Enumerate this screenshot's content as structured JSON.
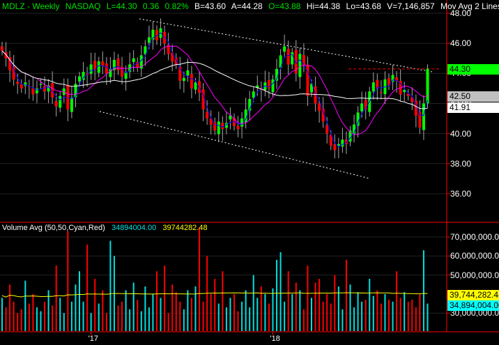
{
  "header": {
    "symbol": "MDLZ - Weekly",
    "exchange": "NASDAQ",
    "last": "L=44.30",
    "change": "0.36",
    "pct": "0.82%",
    "bid": "B=43.60",
    "ask": "A=44.28",
    "open": "O=43.88",
    "high": "Hi=44.38",
    "low": "Lo=43.68",
    "volume": "V=7,146,857",
    "study": "Mov Avg 2 Lines ..."
  },
  "volume_header": {
    "title": "Volume Avg (50,50,Cyan,Red)",
    "vol": "34894004.00",
    "avg": "39744282.48"
  },
  "colors": {
    "up": "#00ff00",
    "down": "#ff0000",
    "ma_fast": "#ff00ff",
    "ma_slow": "#ffffff",
    "ma_short": "#0000ff",
    "vol_up": "#00e0e0",
    "vol_down": "#ff0000",
    "vol_avg": "#ffff00",
    "axis": "#ff0000"
  },
  "chart_data": [
    {
      "type": "candlestick",
      "title": "MDLZ - Weekly",
      "ylim": [
        34.5,
        49
      ],
      "y_ticks": [
        "48.00",
        "46.00",
        "44.00",
        "42.00",
        "40.00",
        "38.00",
        "36.00"
      ],
      "y_tick_values": [
        48,
        46,
        44,
        42,
        40,
        38,
        36
      ],
      "x_ticks": [
        "'17",
        "'18"
      ],
      "x_tick_index": [
        23,
        70
      ],
      "price_labels": [
        {
          "text": "44.30",
          "value": 44.3,
          "bg": "#00ff00"
        },
        {
          "text": "42.50",
          "value": 42.5,
          "bg": "#c0c0c0"
        },
        {
          "text": "41.91",
          "value": 41.91,
          "bg": "#ffffff"
        }
      ],
      "resistance": 44.3,
      "closes": [
        45.5,
        45,
        44.2,
        43.6,
        43.3,
        43.0,
        43.4,
        43.1,
        42.6,
        43.0,
        43.3,
        42.8,
        43.2,
        42.4,
        41.8,
        42.5,
        43.0,
        41.6,
        42.4,
        43.3,
        43.8,
        44.1,
        43.9,
        44.6,
        44.2,
        44.8,
        44.5,
        44.0,
        44.3,
        44.9,
        44.2,
        43.8,
        44.1,
        44.6,
        45.0,
        44.4,
        45.2,
        45.8,
        46.4,
        46.9,
        46.2,
        47.0,
        46.0,
        45.3,
        44.8,
        44.6,
        43.5,
        43.7,
        44.2,
        43.0,
        43.4,
        42.7,
        41.6,
        41.0,
        40.6,
        40.2,
        40.8,
        40.3,
        40.7,
        41.2,
        40.5,
        40.3,
        41.0,
        41.6,
        42.3,
        42.8,
        43.2,
        42.9,
        43.4,
        43.0,
        43.6,
        44.3,
        45.2,
        45.8,
        44.6,
        45.4,
        44.0,
        45.3,
        44.5,
        42.5,
        43.3,
        42.0,
        41.5,
        40.8,
        40.0,
        39.2,
        38.9,
        39.3,
        39.6,
        39.3,
        40.2,
        40.6,
        41.4,
        42.0,
        41.6,
        42.8,
        43.4,
        43.0,
        42.7,
        43.6,
        43.2,
        43.9,
        43.5,
        42.6,
        42.9,
        42.5,
        42.1,
        41.2,
        40.4,
        42.0,
        44.3
      ]
    },
    {
      "type": "bar",
      "title": "Volume Avg (50,50,Cyan,Red)",
      "ylim": [
        20,
        75
      ],
      "unit": "millions",
      "y_ticks": [
        "70,000,000.00",
        "60,000,000.00",
        "50,000,000.00",
        "30,000,000.00"
      ],
      "y_tick_values": [
        70,
        60,
        50,
        30
      ],
      "value_labels": [
        {
          "text": "39,744,282.48",
          "value": 39.74,
          "bg": "#ffff00"
        },
        {
          "text": "34,894,004.00",
          "value": 34.89,
          "bg": "#00ffff"
        }
      ],
      "volumes": [
        38,
        33,
        45,
        36,
        30,
        32,
        47,
        35,
        40,
        33,
        31,
        36,
        42,
        34,
        55,
        38,
        30,
        73,
        36,
        45,
        52,
        36,
        66,
        30,
        48,
        35,
        42,
        30,
        68,
        60,
        34,
        36,
        42,
        32,
        46,
        37,
        31,
        44,
        33,
        40,
        52,
        38,
        55,
        30,
        45,
        41,
        36,
        32,
        42,
        38,
        44,
        75,
        36,
        60,
        40,
        48,
        35,
        52,
        33,
        38,
        40,
        31,
        36,
        42,
        33,
        50,
        38,
        44,
        40,
        35,
        43,
        58,
        62,
        36,
        52,
        40,
        46,
        42,
        32,
        55,
        38,
        46,
        48,
        36,
        40,
        35,
        50,
        44,
        32,
        58,
        45,
        33,
        41,
        36,
        37,
        48,
        39,
        42,
        35,
        40,
        37,
        36,
        52,
        38,
        41,
        36,
        37,
        33,
        40,
        63,
        35
      ]
    }
  ]
}
